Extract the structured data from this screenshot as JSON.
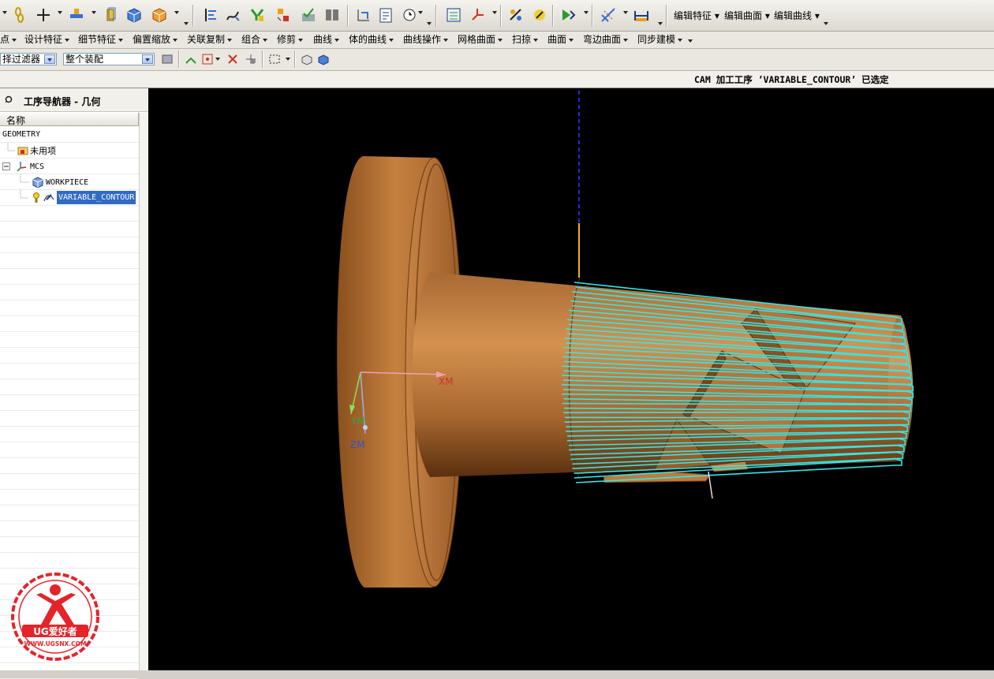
{
  "toolbar_main": {
    "edit_feature_label": "编辑特征",
    "edit_surface_label": "编辑曲面",
    "edit_curve_label": "编辑曲线"
  },
  "menu_bar": {
    "items": [
      {
        "label": "点"
      },
      {
        "label": "设计特征"
      },
      {
        "label": "细节特征"
      },
      {
        "label": "偏置缩放"
      },
      {
        "label": "关联复制"
      },
      {
        "label": "组合"
      },
      {
        "label": "修剪"
      },
      {
        "label": "曲线"
      },
      {
        "label": "体的曲线"
      },
      {
        "label": "曲线操作"
      },
      {
        "label": "网格曲面"
      },
      {
        "label": "扫掠"
      },
      {
        "label": "曲面"
      },
      {
        "label": "弯边曲面"
      },
      {
        "label": "同步建模"
      }
    ]
  },
  "selection_bar": {
    "filter_value": "择过滤器",
    "scope_value": "整个装配"
  },
  "status": {
    "message": "CAM 加工工序 ’VARIABLE_CONTOUR’ 已选定"
  },
  "navigator": {
    "title": "工序导航器 - 几何",
    "column_name": "名称",
    "items": [
      {
        "label": "GEOMETRY",
        "icon": "none"
      },
      {
        "label": "未用项",
        "icon": "folder-icon"
      },
      {
        "label": "MCS",
        "icon": "mcs-axes-icon"
      },
      {
        "label": "WORKPIECE",
        "icon": "workpiece-icon"
      },
      {
        "label": "VARIABLE_CONTOUR",
        "icon": "operation-icon",
        "selected": true
      }
    ]
  },
  "viewport": {
    "background": "#000000",
    "axis_x_label": "XM",
    "axis_y_label": "YM",
    "axis_z_label": "ZM",
    "part_color": "#b8743a",
    "toolpath_color": "#33e6e6"
  },
  "watermark": {
    "brand": "UG爱好者",
    "url": "WWW.UGSNX.COM",
    "color": "#e4242a"
  }
}
